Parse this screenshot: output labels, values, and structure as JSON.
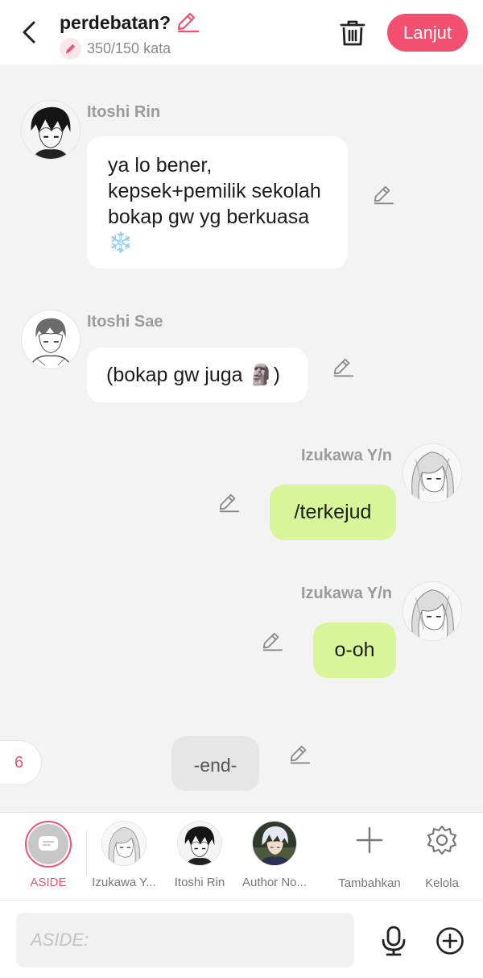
{
  "header": {
    "title": "perdebatan?",
    "word_count": "350/150 kata",
    "next_label": "Lanjut",
    "accent_color": "#f2506e"
  },
  "messages": [
    {
      "author": "Itoshi Rin",
      "side": "left",
      "text": "ya lo bener, kepsek+pemilik sekolah bokap gw yg berkuasa ❄️"
    },
    {
      "author": "Itoshi Sae",
      "side": "left",
      "text": "(bokap gw juga 🗿)"
    },
    {
      "author": "Izukawa Y/n",
      "side": "right",
      "text": "/terkejud"
    },
    {
      "author": "Izukawa Y/n",
      "side": "right",
      "text": "o-oh"
    },
    {
      "author": "",
      "side": "aside",
      "text": "-end-"
    }
  ],
  "page_number": "6",
  "characters": [
    {
      "label": "ASIDE",
      "selected": true
    },
    {
      "label": "Izukawa Y..."
    },
    {
      "label": "Itoshi Rin"
    },
    {
      "label": "Author No..."
    }
  ],
  "tools": {
    "add_label": "Tambahkan",
    "manage_label": "Kelola"
  },
  "composer": {
    "placeholder": "ASIDE:"
  },
  "icons": [
    "back-arrow-icon",
    "pencil-icon",
    "trash-icon",
    "mic-icon",
    "plus-circle-icon",
    "gear-icon",
    "plus-icon",
    "chat-bubble-icon"
  ]
}
